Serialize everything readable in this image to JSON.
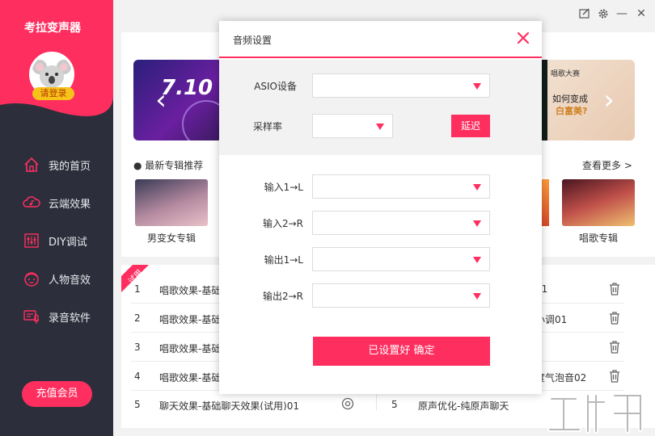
{
  "app": {
    "title": "考拉变声器",
    "login_label": "请登录"
  },
  "sidebar": {
    "items": [
      {
        "label": "我的首页",
        "icon": "home-icon"
      },
      {
        "label": "云端效果",
        "icon": "cloud-music-icon"
      },
      {
        "label": "DIY调试",
        "icon": "equalizer-icon"
      },
      {
        "label": "人物音效",
        "icon": "character-face-icon"
      },
      {
        "label": "录音软件",
        "icon": "recording-software-icon"
      }
    ],
    "recharge_label": "充值会员"
  },
  "window": {
    "controls": [
      "feedback-icon",
      "gear-icon",
      "minimize-icon",
      "close-icon"
    ],
    "minimize_glyph": "—",
    "close_glyph": "✕"
  },
  "home": {
    "banner_left_text": "7.10",
    "banner_right_lines": [
      "如何变成",
      "白富美?"
    ],
    "banner_right_top": "唱歌大赛",
    "section_title": "● 最新专辑推荐",
    "see_more": "查看更多 >",
    "albums": [
      {
        "caption": "男变女专辑"
      },
      {
        "caption": "唱歌专辑"
      }
    ],
    "trial_ribbon": "试用",
    "rows": [
      {
        "num": "1",
        "left": "唱歌效果-基础",
        "right": "01"
      },
      {
        "num": "2",
        "left": "唱歌效果-基础",
        "right": "小调01"
      },
      {
        "num": "3",
        "left": "唱歌效果-基础",
        "right": ""
      },
      {
        "num": "4",
        "left": "唱歌效果-基础",
        "right": "度气泡音02"
      },
      {
        "num": "5",
        "left": "聊天效果-基础聊天效果(试用)01",
        "right_num": "5",
        "right": "原声优化-纯原声聊天"
      }
    ]
  },
  "dialog": {
    "title": "音频设置",
    "asio_label": "ASIO设备",
    "asio_value": "",
    "rate_label": "采样率",
    "rate_value": "",
    "delay_label": "延迟",
    "in1_label": "输入1→L",
    "in2_label": "输入2→R",
    "out1_label": "输出1→L",
    "out2_label": "输出2→R",
    "confirm_label": "已设置好 确定"
  },
  "colors": {
    "accent": "#fe2e5f",
    "sidebar_bg": "#2c2f3b",
    "main_bg": "#f2f2f2",
    "badge": "#f7c21a"
  }
}
